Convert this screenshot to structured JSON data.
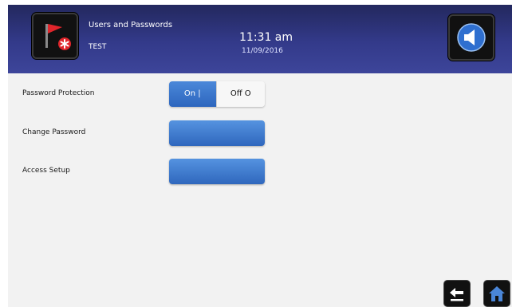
{
  "header": {
    "title": "Users and Passwords",
    "subtitle": "TEST",
    "time": "11:31 am",
    "date": "11/09/2016",
    "alarm_icon": "red-flag-alarm-icon",
    "speaker_icon": "speaker-icon"
  },
  "rows": {
    "password_protection": {
      "label": "Password Protection",
      "on_label": "On |",
      "off_label": "Off O",
      "state": "On"
    },
    "change_password": {
      "label": "Change Password",
      "button_label": ""
    },
    "access_setup": {
      "label": "Access Setup",
      "button_label": ""
    }
  },
  "footer": {
    "back_icon": "back-arrow-icon",
    "home_icon": "home-icon"
  },
  "colors": {
    "header_bg": "#333a8a",
    "accent_blue": "#3b78cc",
    "panel_bg": "#f2f2f2"
  }
}
